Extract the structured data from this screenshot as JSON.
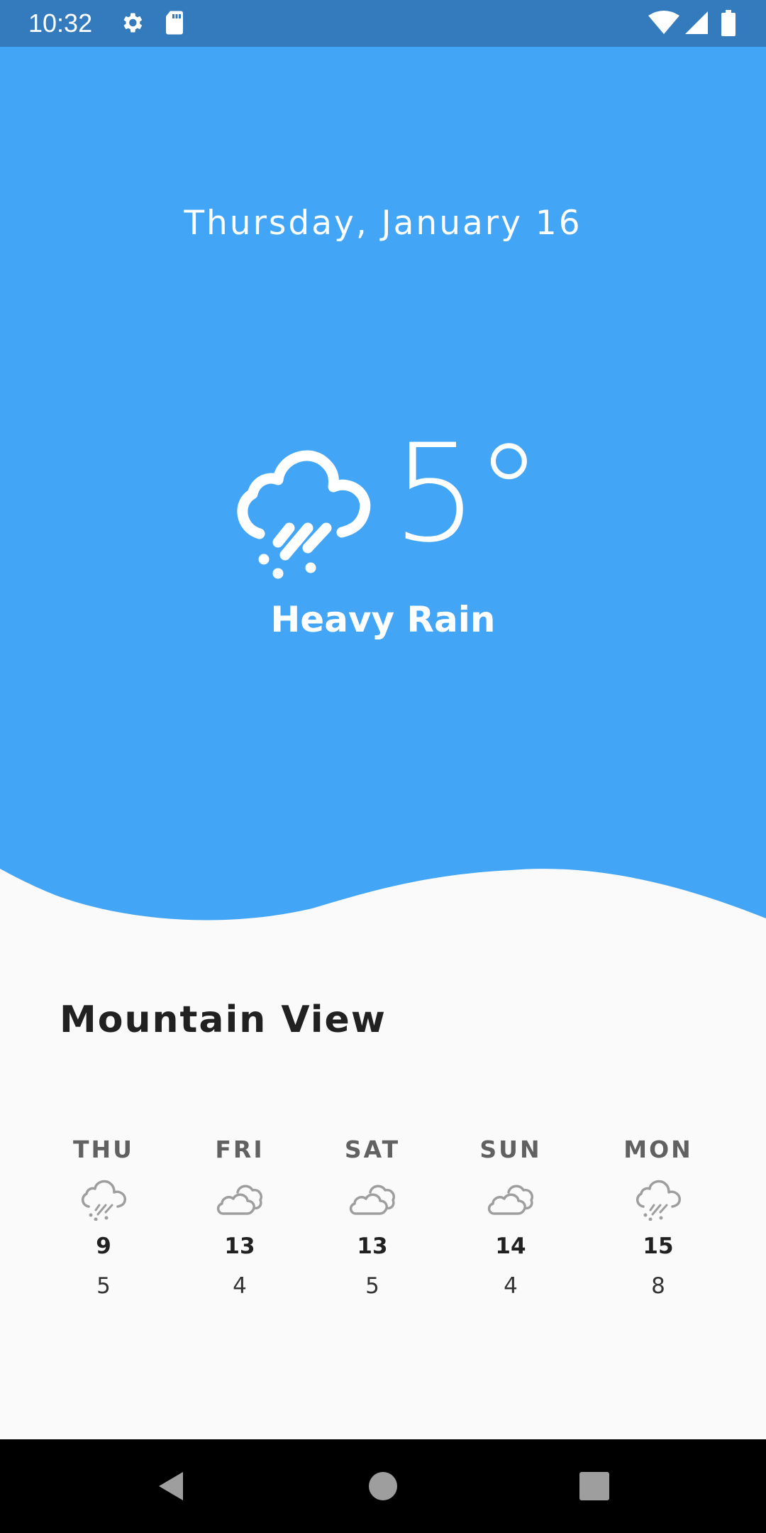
{
  "status_bar": {
    "time": "10:32",
    "icons": [
      "gear-icon",
      "sd-card-icon",
      "wifi-icon",
      "cell-signal-icon",
      "battery-icon"
    ]
  },
  "colors": {
    "hero_bg": "#42a5f5",
    "status_bar_bg": "#347bbd",
    "page_bg": "#fafafa"
  },
  "current": {
    "date": "Thursday, January 16",
    "temperature": "5°",
    "condition": "Heavy Rain",
    "icon": "heavy-rain-icon"
  },
  "location": {
    "city": "Mountain View"
  },
  "forecast": [
    {
      "day": "THU",
      "icon": "heavy-rain-icon",
      "high": "9",
      "low": "5"
    },
    {
      "day": "FRI",
      "icon": "cloudy-icon",
      "high": "13",
      "low": "4"
    },
    {
      "day": "SAT",
      "icon": "cloudy-icon",
      "high": "13",
      "low": "5"
    },
    {
      "day": "SUN",
      "icon": "cloudy-icon",
      "high": "14",
      "low": "4"
    },
    {
      "day": "MON",
      "icon": "heavy-rain-icon",
      "high": "15",
      "low": "8"
    }
  ],
  "nav_bar": {
    "buttons": [
      "back-icon",
      "home-icon",
      "recents-icon"
    ]
  }
}
